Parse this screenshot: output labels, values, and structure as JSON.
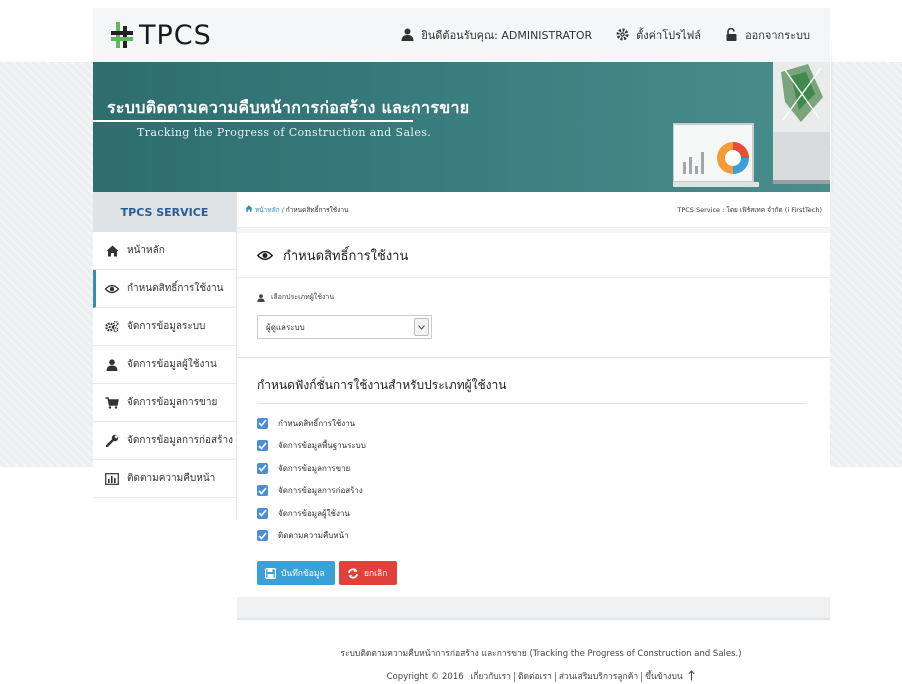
{
  "header": {
    "logo_text": "TPCS",
    "welcome_label": "ยินดีต้อนรับคุณ: ADMINISTRATOR",
    "profile_label": "ตั้งค่าโปรไฟล์",
    "logout_label": "ออกจากระบบ"
  },
  "banner": {
    "title": "ระบบติดตามความคืบหน้าการก่อสร้าง และการขาย",
    "subtitle": "Tracking the Progress of Construction and Sales."
  },
  "sidebar": {
    "header": "TPCS SERVICE",
    "items": [
      {
        "label": "หน้าหลัก",
        "icon": "home-icon"
      },
      {
        "label": "กำหนดสิทธิ์การใช้งาน",
        "icon": "eye-icon"
      },
      {
        "label": "จัดการข้อมูลระบบ",
        "icon": "gears-icon"
      },
      {
        "label": "จัดการข้อมูลผู้ใช้งาน",
        "icon": "user-icon"
      },
      {
        "label": "จัดการข้อมูลการขาย",
        "icon": "cart-icon"
      },
      {
        "label": "จัดการข้อมูลการก่อสร้าง",
        "icon": "wrench-icon"
      },
      {
        "label": "ติดตามความคืบหน้า",
        "icon": "chart-icon"
      }
    ]
  },
  "breadcrumb": {
    "home": "หน้าหลัก",
    "separator": "/",
    "current": "กำหนดสิทธิ์การใช้งาน",
    "company": "TPCS Service : โดย เฟิร์สเทค จำกัด (i FirstTech)"
  },
  "page": {
    "title": "กำหนดสิทธิ์การใช้งาน",
    "select_label": "เลือกประเภทผู้ใช้งาน",
    "select_value": "ผู้ดูแลระบบ",
    "section_title": "กำหนดฟังก์ชั่นการใช้งานสำหรับประเภทผู้ใช้งาน",
    "permissions": [
      {
        "label": "กำหนดสิทธิ์การใช้งาน",
        "checked": true
      },
      {
        "label": "จัดการข้อมูลพื้นฐานระบบ",
        "checked": true
      },
      {
        "label": "จัดการข้อมูลการขาย",
        "checked": true
      },
      {
        "label": "จัดการข้อมูลการก่อสร้าง",
        "checked": true
      },
      {
        "label": "จัดการข้อมูลผู้ใช้งาน",
        "checked": true
      },
      {
        "label": "ติดตามความคืบหน้า",
        "checked": true
      }
    ],
    "save_label": "บันทึกข้อมูล",
    "cancel_label": "ยกเลิก"
  },
  "footer": {
    "line1": "ระบบติดตามความคืบหน้าการก่อสร้าง และการขาย  (Tracking the Progress of Construction and Sales.)",
    "copyright": "Copyright © 2016",
    "links": [
      "เกี่ยวกับเรา",
      "ติดต่อเรา",
      "ส่วนเสริมบริการลูกค้า",
      "ขึ้นข้างบน"
    ]
  },
  "colors": {
    "banner": "#3b7f80",
    "accent": "#2f8fb5",
    "save": "#3aa0d8",
    "cancel": "#e0413b",
    "logo_green": "#5cb85c"
  }
}
